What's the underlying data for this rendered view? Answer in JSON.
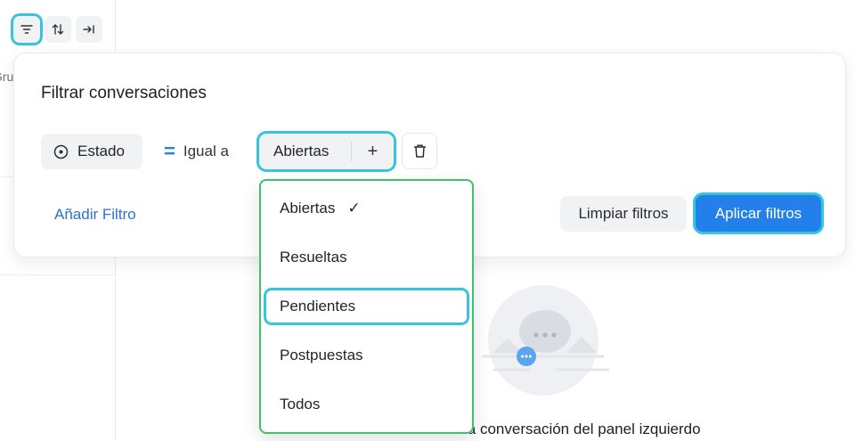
{
  "sidebar": {
    "partial_label": "Gru"
  },
  "toolbar": {
    "filter_icon": "filter-icon",
    "sort_icon": "sort-icon",
    "collapse_icon": "collapse-right-icon"
  },
  "filter_panel": {
    "title": "Filtrar conversaciones",
    "attribute": "Estado",
    "operator": "Igual a",
    "value": "Abiertas",
    "value_add": "+",
    "add_filter": "Añadir Filtro",
    "clear_button": "Limpiar filtros",
    "apply_button": "Aplicar filtros"
  },
  "dropdown": {
    "items": [
      {
        "label": "Abiertas",
        "selected": true
      },
      {
        "label": "Resueltas",
        "selected": false
      },
      {
        "label": "Pendientes",
        "selected": false
      },
      {
        "label": "Postpuestas",
        "selected": false
      },
      {
        "label": "Todos",
        "selected": false
      }
    ],
    "check_mark": "✓"
  },
  "empty_state": {
    "text": "Seleccione una conversación del panel izquierdo"
  },
  "colors": {
    "accent": "#2380ea",
    "link": "#2a73c9",
    "highlight": "#35c6dd",
    "dropdown_border": "#3fc26a"
  }
}
